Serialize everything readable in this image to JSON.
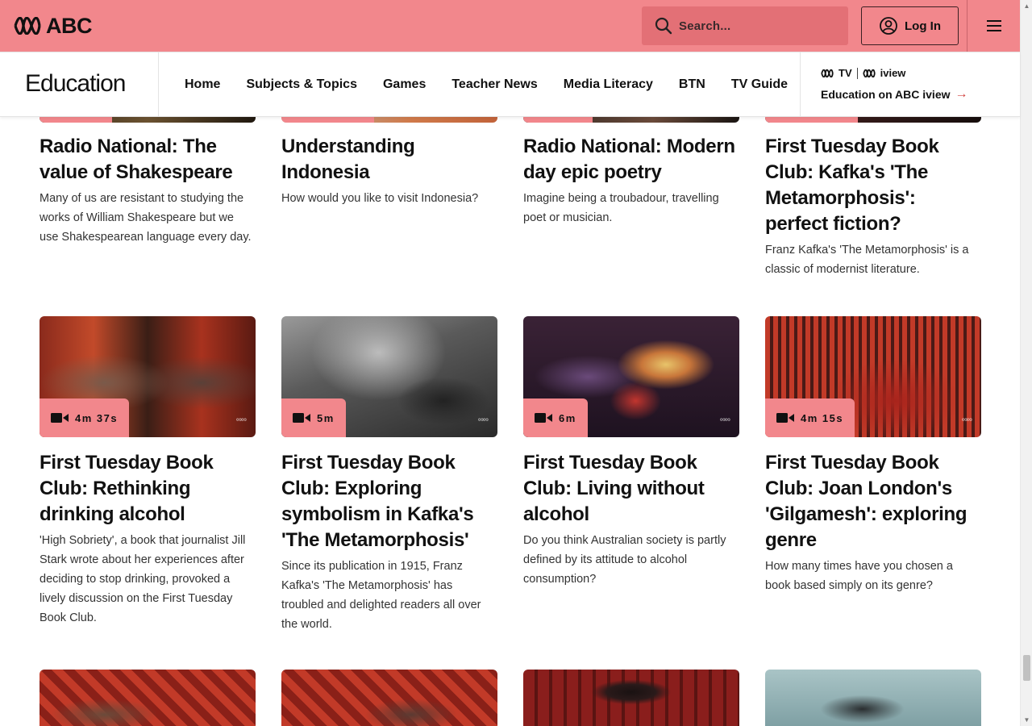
{
  "brand": {
    "logo_text": "ABC",
    "accent": "#f2878c"
  },
  "header": {
    "search_placeholder": "Search...",
    "login_label": "Log In"
  },
  "subnav": {
    "title": "Education",
    "items": [
      "Home",
      "Subjects & Topics",
      "Games",
      "Teacher News",
      "Media Literacy",
      "BTN",
      "TV Guide"
    ],
    "iview_logo_tv": "TV",
    "iview_logo_iview": "iview",
    "iview_link": "Education on ABC iview"
  },
  "row1": [
    {
      "title": "Radio National: The value of Shakespeare",
      "desc": "Many of us are resistant to studying the works of William Shakespeare but we use Shakespearean language every day."
    },
    {
      "title": "Understanding Indonesia",
      "desc": "How would you like to visit Indonesia?"
    },
    {
      "title": "Radio National: Modern day epic poetry",
      "desc": "Imagine being a troubadour, travelling poet or musician."
    },
    {
      "title": "First Tuesday Book Club: Kafka's 'The Metamorphosis': perfect fiction?",
      "desc": "Franz Kafka's 'The Metamorphosis' is a classic of modernist literature."
    }
  ],
  "row2": [
    {
      "duration": "4m 37s",
      "title": "First Tuesday Book Club: Rethinking drinking alcohol",
      "desc": "'High Sobriety', a book that journalist Jill Stark wrote about her experiences after deciding to stop drinking, provoked a lively discussion on the First Tuesday Book Club."
    },
    {
      "duration": "5m",
      "title": "First Tuesday Book Club: Exploring symbolism in Kafka's 'The Metamorphosis'",
      "desc": "Since its publication in 1915, Franz Kafka's 'The Metamorphosis' has troubled and delighted readers all over the world."
    },
    {
      "duration": "6m",
      "title": "First Tuesday Book Club: Living without alcohol",
      "desc": "Do you think Australian society is partly defined by its attitude to alcohol consumption?"
    },
    {
      "duration": "4m 15s",
      "title": "First Tuesday Book Club: Joan London's 'Gilgamesh': exploring genre",
      "desc": "How many times have you chosen a book based simply on its genre?"
    }
  ]
}
